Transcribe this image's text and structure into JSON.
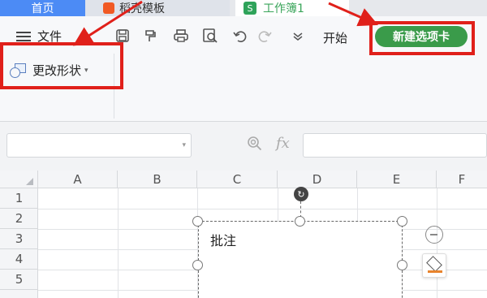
{
  "tabs": {
    "home": "首页",
    "template": "稻壳模板",
    "workbook": "工作簿1",
    "workbook_icon": "S"
  },
  "toolbar": {
    "file_label": "文件",
    "start_label": "开始",
    "new_tab_label": "新建选项卡",
    "change_shape_label": "更改形状",
    "quick_icons": [
      "save-icon",
      "format-painter-icon",
      "print-icon",
      "print-preview-icon",
      "undo-icon",
      "redo-icon",
      "more-dropdown-icon"
    ]
  },
  "formula_bar": {
    "name_box_value": "",
    "fx_label": "fx",
    "formula_value": ""
  },
  "grid": {
    "columns": [
      "A",
      "B",
      "C",
      "D",
      "E",
      "F"
    ],
    "rows": [
      "1",
      "2",
      "3",
      "4",
      "5"
    ]
  },
  "comment": {
    "text": "批注"
  },
  "colors": {
    "home_tab": "#4c8bf5",
    "new_tab_button": "#3a9b4a",
    "annotation_red": "#e0201a",
    "fill_accent": "#e8842d"
  }
}
